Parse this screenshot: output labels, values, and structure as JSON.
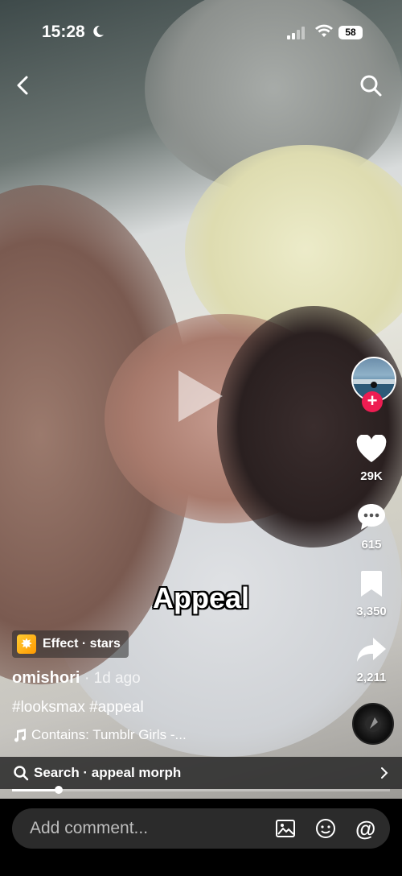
{
  "status_bar": {
    "time": "15:28",
    "battery": "58"
  },
  "video": {
    "caption_overlay": "Appeal"
  },
  "actions": {
    "likes": "29K",
    "comments": "615",
    "saves": "3,350",
    "shares": "2,211"
  },
  "effect": {
    "label": "Effect · stars"
  },
  "post": {
    "username": "omishori",
    "time_ago": "· 1d ago",
    "hashtags": "#looksmax #appeal",
    "music": "Contains: Tumblr Girls -..."
  },
  "search": {
    "label": "Search · appeal morph"
  },
  "progress": {
    "fraction": 0.124
  },
  "comment": {
    "placeholder": "Add comment..."
  },
  "icons": [
    "back-icon",
    "search-icon",
    "heart-icon",
    "comment-icon",
    "bookmark-icon",
    "share-icon",
    "image-icon",
    "emoji-icon",
    "mention-icon",
    "music-note-icon",
    "moon-icon",
    "wifi-icon",
    "signal-icon",
    "chevron-right-icon",
    "play-icon"
  ],
  "colors": {
    "follow": "#ee1d52",
    "effect": "#ffaa22",
    "comment_bg": "#2b2b2b"
  }
}
